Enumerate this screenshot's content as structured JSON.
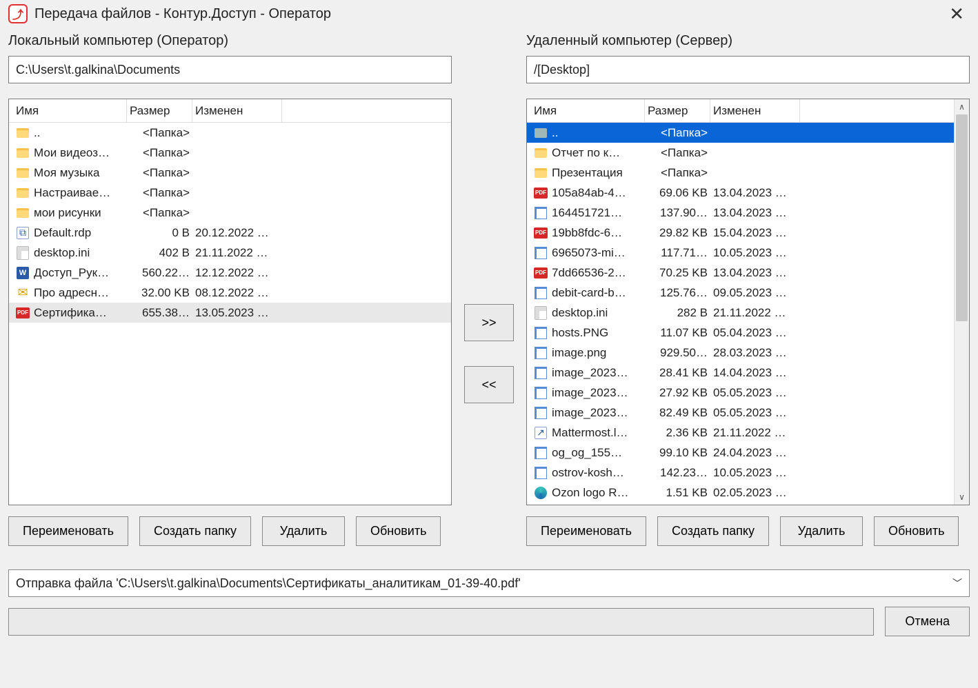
{
  "window": {
    "title": "Передача файлов - Контур.Доступ - Оператор"
  },
  "local": {
    "title": "Локальный компьютер (Оператор)",
    "path": "C:\\Users\\t.galkina\\Documents",
    "columns": {
      "name": "Имя",
      "size": "Размер",
      "modified": "Изменен"
    },
    "rows": [
      {
        "icon": "folder",
        "name": "..",
        "size": "<Папка>",
        "modified": ""
      },
      {
        "icon": "folder",
        "name": "Мои видеоз…",
        "size": "<Папка>",
        "modified": ""
      },
      {
        "icon": "folder",
        "name": "Моя музыка",
        "size": "<Папка>",
        "modified": ""
      },
      {
        "icon": "folder",
        "name": "Настраивае…",
        "size": "<Папка>",
        "modified": ""
      },
      {
        "icon": "folder",
        "name": "мои рисунки",
        "size": "<Папка>",
        "modified": ""
      },
      {
        "icon": "rdp",
        "name": "Default.rdp",
        "size": "0 B",
        "modified": "20.12.2022 …"
      },
      {
        "icon": "ini",
        "name": "desktop.ini",
        "size": "402 B",
        "modified": "21.11.2022 …"
      },
      {
        "icon": "word",
        "name": "Доступ_Рук…",
        "size": "560.22…",
        "modified": "12.12.2022 …"
      },
      {
        "icon": "mail",
        "name": "Про адресн…",
        "size": "32.00 KB",
        "modified": "08.12.2022 …"
      },
      {
        "icon": "pdf",
        "name": "Сертифика…",
        "size": "655.38…",
        "modified": "13.05.2023 …",
        "selected": true
      }
    ]
  },
  "remote": {
    "title": "Удаленный компьютер (Сервер)",
    "path": "/[Desktop]",
    "columns": {
      "name": "Имя",
      "size": "Размер",
      "modified": "Изменен"
    },
    "rows": [
      {
        "icon": "folder-alt",
        "name": "..",
        "size": "<Папка>",
        "modified": "",
        "selected": true
      },
      {
        "icon": "folder",
        "name": "Отчет по к…",
        "size": "<Папка>",
        "modified": ""
      },
      {
        "icon": "folder",
        "name": "Презентация",
        "size": "<Папка>",
        "modified": ""
      },
      {
        "icon": "pdf",
        "name": "105a84ab-4…",
        "size": "69.06 KB",
        "modified": "13.04.2023 …"
      },
      {
        "icon": "img",
        "name": "164451721…",
        "size": "137.90…",
        "modified": "13.04.2023 …"
      },
      {
        "icon": "pdf",
        "name": "19bb8fdc-6…",
        "size": "29.82 KB",
        "modified": "15.04.2023 …"
      },
      {
        "icon": "img",
        "name": "6965073-mi…",
        "size": "117.71…",
        "modified": "10.05.2023 …"
      },
      {
        "icon": "pdf",
        "name": "7dd66536-2…",
        "size": "70.25 KB",
        "modified": "13.04.2023 …"
      },
      {
        "icon": "img",
        "name": "debit-card-b…",
        "size": "125.76…",
        "modified": "09.05.2023 …"
      },
      {
        "icon": "ini",
        "name": "desktop.ini",
        "size": "282 B",
        "modified": "21.11.2022 …"
      },
      {
        "icon": "img",
        "name": "hosts.PNG",
        "size": "11.07 KB",
        "modified": "05.04.2023 …"
      },
      {
        "icon": "img",
        "name": "image.png",
        "size": "929.50…",
        "modified": "28.03.2023 …"
      },
      {
        "icon": "img",
        "name": "image_2023…",
        "size": "28.41 KB",
        "modified": "14.04.2023 …"
      },
      {
        "icon": "img",
        "name": "image_2023…",
        "size": "27.92 KB",
        "modified": "05.05.2023 …"
      },
      {
        "icon": "img",
        "name": "image_2023…",
        "size": "82.49 KB",
        "modified": "05.05.2023 …"
      },
      {
        "icon": "lnk",
        "name": "Mattermost.l…",
        "size": "2.36 KB",
        "modified": "21.11.2022 …"
      },
      {
        "icon": "img",
        "name": "og_og_155…",
        "size": "99.10 KB",
        "modified": "24.04.2023 …"
      },
      {
        "icon": "img",
        "name": "ostrov-kosh…",
        "size": "142.23…",
        "modified": "10.05.2023 …"
      },
      {
        "icon": "edge",
        "name": "Ozon logo R…",
        "size": "1.51 KB",
        "modified": "02.05.2023 …"
      }
    ]
  },
  "transfer": {
    "to_remote": ">>",
    "to_local": "<<"
  },
  "buttons": {
    "rename": "Переименовать",
    "mkdir": "Создать папку",
    "delete": "Удалить",
    "refresh": "Обновить",
    "cancel": "Отмена"
  },
  "status": {
    "text": "Отправка файла 'C:\\Users\\t.galkina\\Documents\\Сертификаты_аналитикам_01-39-40.pdf'"
  }
}
